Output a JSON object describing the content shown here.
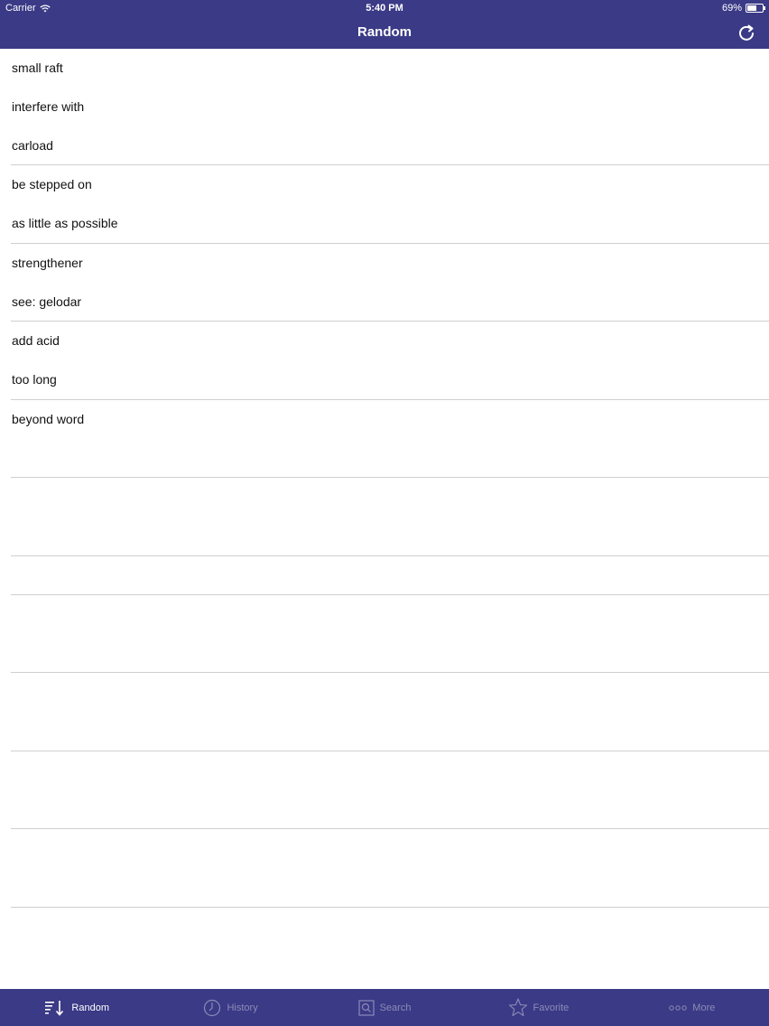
{
  "status_bar": {
    "carrier": "Carrier",
    "time": "5:40 PM",
    "battery": "69%",
    "battery_level": 0.69
  },
  "nav": {
    "title": "Random",
    "refresh_icon": "refresh-icon"
  },
  "items": [
    "small raft",
    "interfere with",
    "carload",
    "be stepped on",
    "as little as possible",
    "strengthener",
    "see: gelodar",
    "add acid",
    "too long",
    "beyond word"
  ],
  "tabs": [
    {
      "label": "Random",
      "icon": "random-sort-icon",
      "active": true
    },
    {
      "label": "History",
      "icon": "history-clock-icon",
      "active": false
    },
    {
      "label": "Search",
      "icon": "search-icon",
      "active": false
    },
    {
      "label": "Favorite",
      "icon": "star-icon",
      "active": false
    },
    {
      "label": "More",
      "icon": "more-dots-icon",
      "active": false
    }
  ],
  "colors": {
    "bar": "#3b3a86",
    "active_tab": "#ffffff",
    "inactive_tab": "#8c8bb8",
    "separator": "#cfcfcf"
  }
}
